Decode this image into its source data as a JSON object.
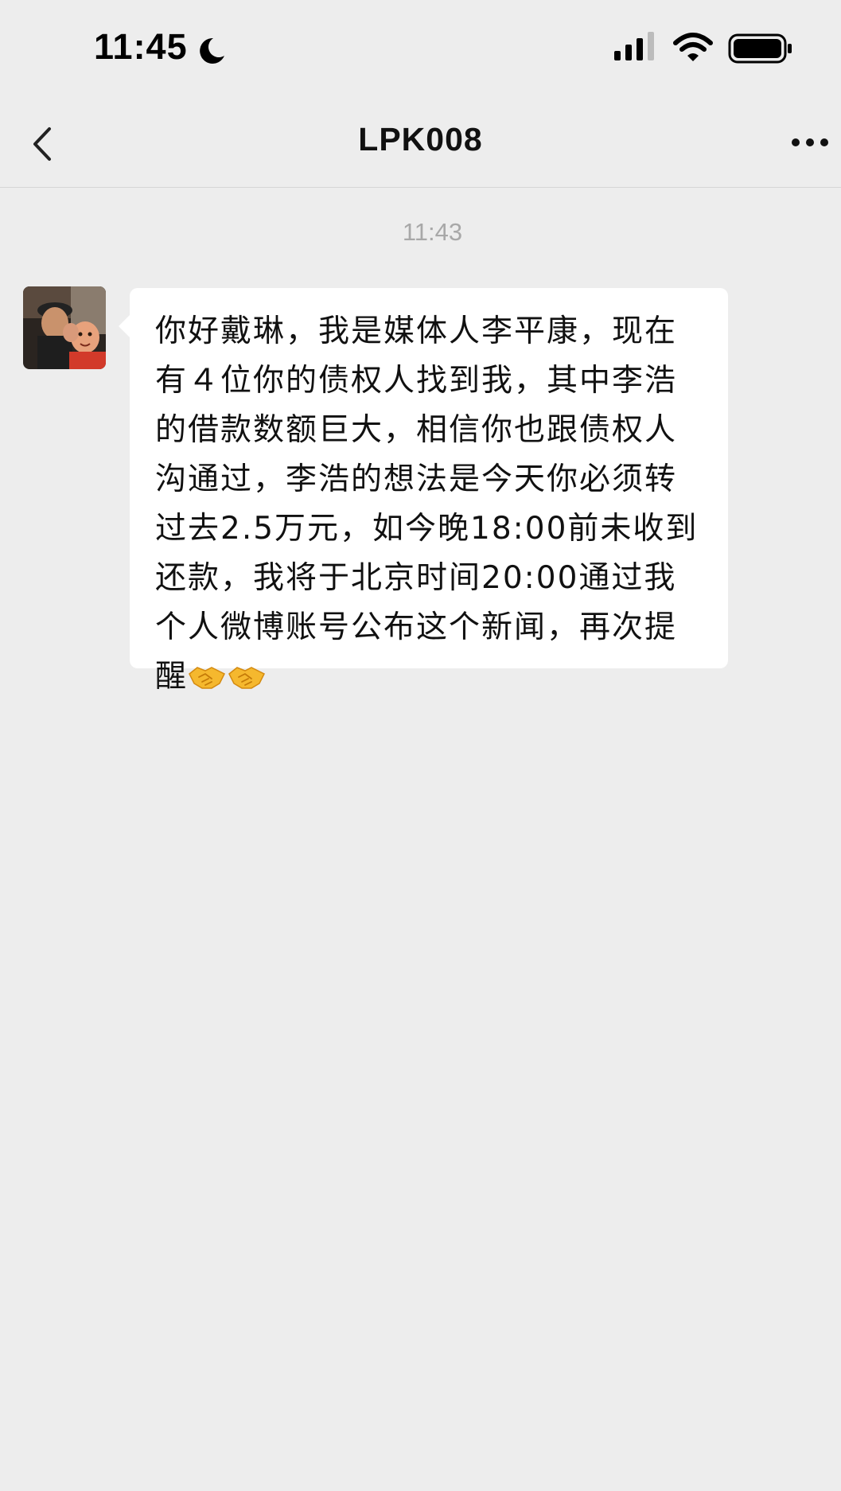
{
  "status_bar": {
    "time": "11:45",
    "icons": [
      "moon-icon",
      "signal-icon",
      "wifi-icon",
      "battery-icon"
    ]
  },
  "nav": {
    "back_icon": "chevron-left-icon",
    "title": "LPK008",
    "more_icon": "ellipsis-icon"
  },
  "chat": {
    "timestamp": "11:43",
    "messages": [
      {
        "sender": "LPK008",
        "text": "你好戴琳，我是媒体人李平康，现在有４位你的债权人找到我，其中李浩的借款数额巨大，相信你也跟债权人沟通过，李浩的想法是今天你必须转过去2.5万元，如今晚18:00前未收到还款，我将于北京时间20:00通过我个人微博账号公布这个新闻，再次提醒",
        "emoji": [
          "handshake-icon",
          "handshake-icon"
        ]
      }
    ]
  },
  "colors": {
    "background": "#ededed",
    "bubble": "#ffffff",
    "text": "#111111",
    "timestamp": "#a8a8a8",
    "emoji": "#f5b82e"
  }
}
